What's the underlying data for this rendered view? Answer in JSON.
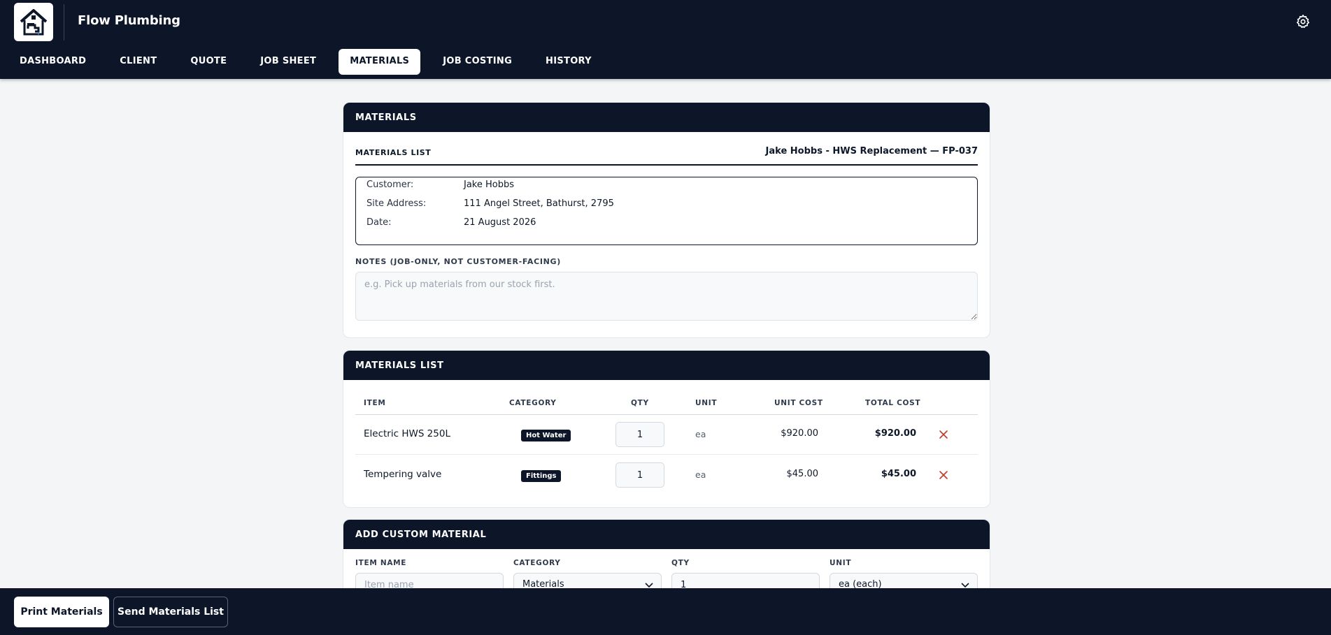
{
  "app": {
    "name": "Flow Plumbing"
  },
  "nav": {
    "tabs": [
      {
        "label": "DASHBOARD"
      },
      {
        "label": "CLIENT"
      },
      {
        "label": "QUOTE"
      },
      {
        "label": "JOB SHEET"
      },
      {
        "label": "MATERIALS",
        "active": true
      },
      {
        "label": "JOB COSTING"
      },
      {
        "label": "HISTORY"
      }
    ]
  },
  "materials_card": {
    "header": "MATERIALS",
    "list_title": "MATERIALS LIST",
    "job_reference": "Jake Hobbs - HWS Replacement — FP-037",
    "info": [
      {
        "label": "Customer:",
        "value": "Jake Hobbs"
      },
      {
        "label": "Site Address:",
        "value": "111 Angel Street, Bathurst, 2795"
      },
      {
        "label": "Date:",
        "value": "21 August 2026"
      }
    ],
    "notes_label": "NOTES (JOB-ONLY, NOT CUSTOMER-FACING)",
    "notes_placeholder": "e.g. Pick up materials from our stock first.",
    "notes_value": ""
  },
  "list_card": {
    "header": "MATERIALS LIST",
    "columns": {
      "item": "ITEM",
      "category": "CATEGORY",
      "qty": "QTY",
      "unit": "UNIT",
      "unit_cost": "UNIT COST",
      "total_cost": "TOTAL COST"
    },
    "rows": [
      {
        "item": "Electric HWS 250L",
        "category": "Hot Water",
        "qty": "1",
        "unit": "ea",
        "unit_cost": "$920.00",
        "total_cost": "$920.00"
      },
      {
        "item": "Tempering valve",
        "category": "Fittings",
        "qty": "1",
        "unit": "ea",
        "unit_cost": "$45.00",
        "total_cost": "$45.00"
      }
    ]
  },
  "custom_card": {
    "header": "ADD CUSTOM MATERIAL",
    "fields": {
      "item_name_label": "ITEM NAME",
      "item_name_placeholder": "Item name",
      "category_label": "CATEGORY",
      "category_value": "Materials",
      "qty_label": "QTY",
      "qty_value": "1",
      "unit_label": "UNIT",
      "unit_value": "ea (each)"
    }
  },
  "actions": {
    "print_label": "Print Materials",
    "send_label": "Send Materials List"
  },
  "colors": {
    "navy": "#0c1628",
    "delete_red": "#c0392b",
    "page_bg": "#f3f5f7"
  }
}
